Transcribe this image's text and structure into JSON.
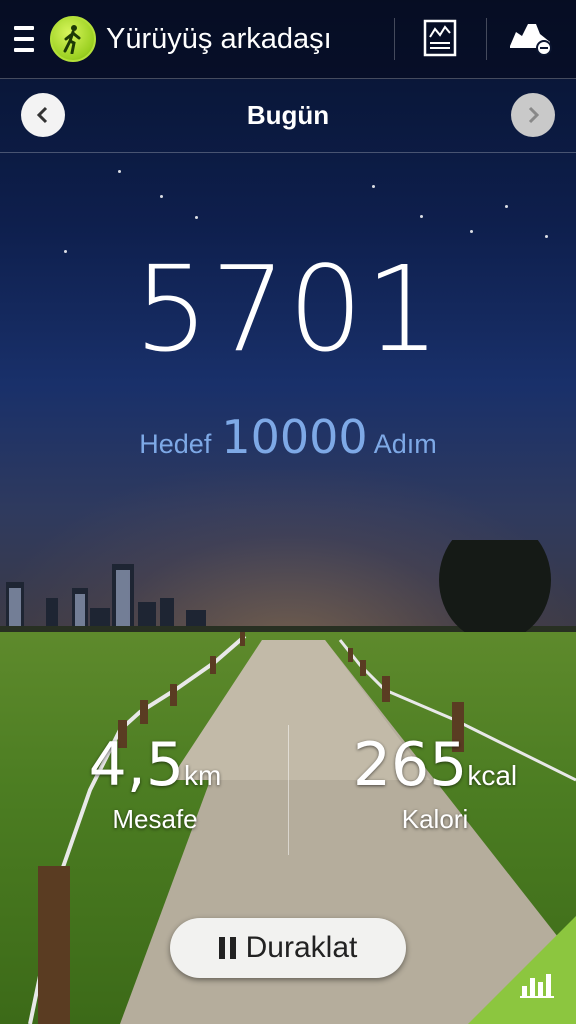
{
  "header": {
    "app_title": "Yürüyüş arkadaşı",
    "icons": {
      "menu": "menu-icon",
      "app": "walker-icon",
      "history": "chart-list-icon",
      "shoe": "shoe-icon"
    }
  },
  "datebar": {
    "label": "Bugün",
    "prev_icon": "chevron-left-icon",
    "next_icon": "chevron-right-icon"
  },
  "steps": {
    "count": "5701",
    "goal_prefix": "Hedef",
    "goal_value": "10000",
    "goal_suffix": "Adım"
  },
  "stats": {
    "distance": {
      "value": "4,5",
      "unit": "km",
      "label": "Mesafe"
    },
    "calories": {
      "value": "265",
      "unit": "kcal",
      "label": "Kalori"
    }
  },
  "actions": {
    "pause_label": "Duraklat",
    "corner_icon": "bar-chart-icon"
  },
  "colors": {
    "accent_green": "#8cc63f",
    "goal_blue": "#7ea9e6"
  }
}
